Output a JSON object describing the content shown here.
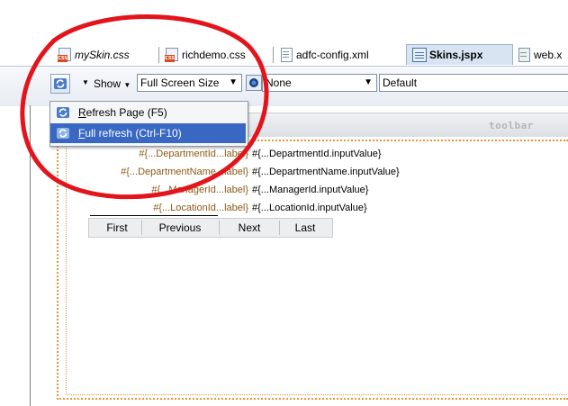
{
  "tabs": [
    {
      "label": "mySkin.css",
      "icon": "css-file-icon",
      "italic": true
    },
    {
      "label": "richdemo.css",
      "icon": "css-file-icon",
      "italic": false
    },
    {
      "label": "adfc-config.xml",
      "icon": "xml-file-icon",
      "italic": false
    },
    {
      "label": "Skins.jspx",
      "icon": "jspx-file-icon",
      "active": true
    },
    {
      "label": "web.x",
      "icon": "web-file-icon",
      "italic": false
    }
  ],
  "toolbar": {
    "show_label": "Show",
    "screen_size": "Full Screen Size",
    "skin_combo": "None",
    "mode_combo": "Default"
  },
  "menu": {
    "items": [
      {
        "label": "Refresh Page (F5)",
        "mnemonic": "R",
        "rest": "efresh Page (F5)"
      },
      {
        "label": "Full refresh (Ctrl-F10)",
        "mnemonic": "F",
        "rest": "ull refresh (Ctrl-F10)",
        "highlighted": true
      }
    ]
  },
  "canvas": {
    "toolbar_facet_label": "toolbar",
    "rows": [
      {
        "label": "#{...DepartmentId...label}",
        "value": "#{...DepartmentId.inputValue}"
      },
      {
        "label": "#{...DepartmentName...label}",
        "value": "#{...DepartmentName.inputValue}"
      },
      {
        "label": "#{...ManagerId...label}",
        "value": "#{...ManagerId.inputValue}"
      },
      {
        "label": "#{...LocationId...label}",
        "value": "#{...LocationId.inputValue}"
      }
    ],
    "nav_buttons": [
      "First",
      "Previous",
      "Next",
      "Last"
    ]
  },
  "colors": {
    "annotation": "#e3141b",
    "menu_highlight": "#3968c2",
    "facet_border": "#e8953a"
  }
}
